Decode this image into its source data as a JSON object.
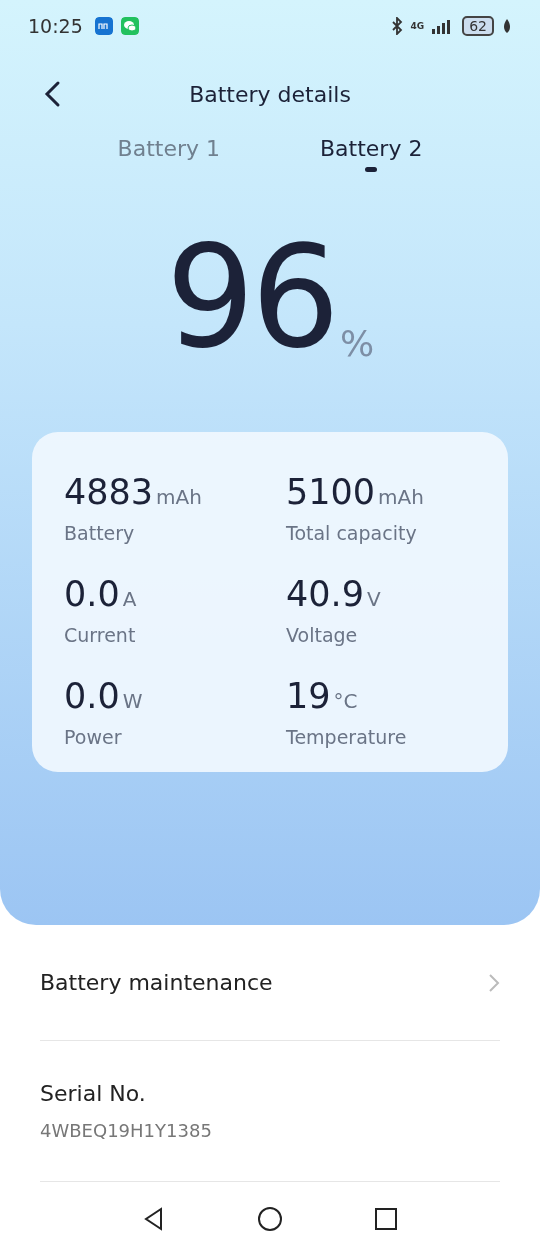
{
  "status_bar": {
    "time": "10:25",
    "network": "4G",
    "battery": "62"
  },
  "header": {
    "title": "Battery details"
  },
  "tabs": [
    {
      "label": "Battery 1",
      "selected": false
    },
    {
      "label": "Battery 2",
      "selected": true
    }
  ],
  "charge": {
    "value": "96",
    "unit": "%"
  },
  "stats": [
    {
      "value": "4883",
      "unit": "mAh",
      "label": "Battery"
    },
    {
      "value": "5100",
      "unit": "mAh",
      "label": "Total capacity"
    },
    {
      "value": "0.0",
      "unit": "A",
      "label": "Current"
    },
    {
      "value": "40.9",
      "unit": "V",
      "label": "Voltage"
    },
    {
      "value": "0.0",
      "unit": "W",
      "label": "Power"
    },
    {
      "value": "19",
      "unit": "°C",
      "label": "Temperature"
    }
  ],
  "list": [
    {
      "kind": "link",
      "title": "Battery maintenance"
    },
    {
      "kind": "info",
      "title": "Serial No.",
      "value": "4WBEQ19H1Y1385"
    }
  ]
}
